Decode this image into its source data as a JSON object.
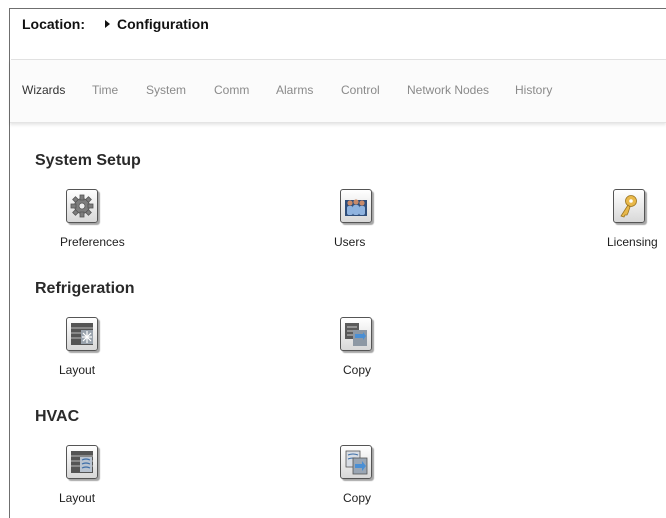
{
  "location": {
    "label": "Location:",
    "crumb": "Configuration"
  },
  "tabs": [
    {
      "label": "Wizards",
      "active": true
    },
    {
      "label": "Time"
    },
    {
      "label": "System"
    },
    {
      "label": "Comm"
    },
    {
      "label": "Alarms"
    },
    {
      "label": "Control"
    },
    {
      "label": "Network Nodes"
    },
    {
      "label": "History"
    }
  ],
  "sections": {
    "system_setup": {
      "title": "System Setup",
      "items": [
        {
          "label": "Preferences",
          "icon": "gear-icon"
        },
        {
          "label": "Users",
          "icon": "users-icon"
        },
        {
          "label": "Licensing",
          "icon": "key-icon"
        }
      ]
    },
    "refrigeration": {
      "title": "Refrigeration",
      "items": [
        {
          "label": "Layout",
          "icon": "refrigeration-layout-icon"
        },
        {
          "label": "Copy",
          "icon": "copy-icon"
        }
      ]
    },
    "hvac": {
      "title": "HVAC",
      "items": [
        {
          "label": "Layout",
          "icon": "hvac-layout-icon"
        },
        {
          "label": "Copy",
          "icon": "copy-icon"
        }
      ]
    }
  },
  "colors": {
    "tab_active": "#333333",
    "tab_inactive": "#8a8a8a",
    "key_gold": "#e8b84a",
    "users_blue": "#3d6ea8"
  }
}
